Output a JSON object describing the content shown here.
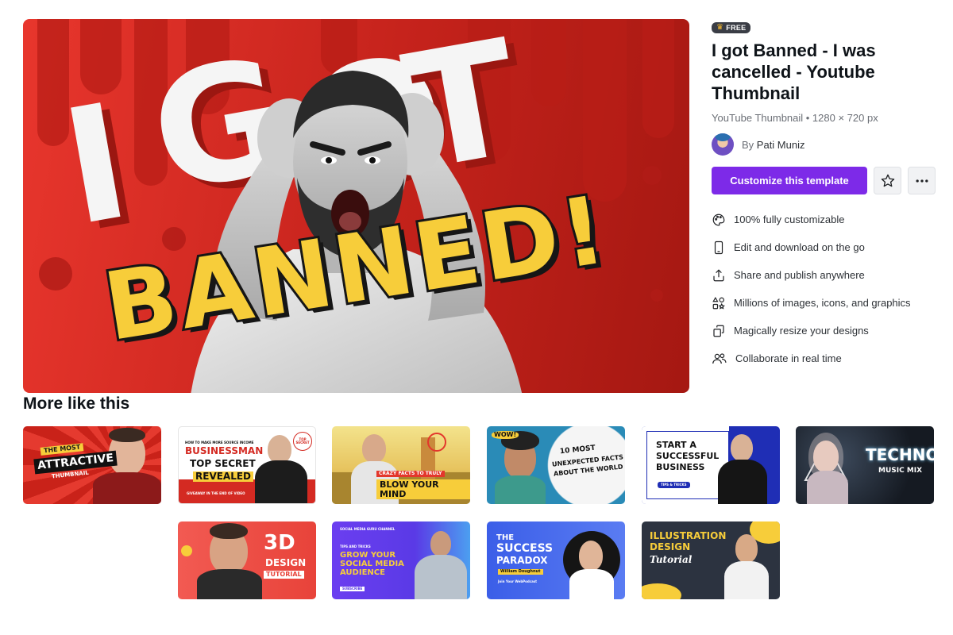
{
  "hero": {
    "big_letters": [
      "I",
      "G",
      "O",
      "T"
    ],
    "headline": "BANNED!"
  },
  "badge": {
    "label": "FREE",
    "icon": "crown-icon"
  },
  "template": {
    "title": "I got Banned - I was cancelled - Youtube Thumbnail",
    "meta": "YouTube Thumbnail • 1280 × 720 px",
    "author_prefix": "By",
    "author_name": "Pati Muniz"
  },
  "actions": {
    "customize_label": "Customize this template",
    "star_icon": "star-icon",
    "more_icon": "more-dots-icon"
  },
  "features": [
    {
      "icon": "palette-icon",
      "label": "100% fully customizable"
    },
    {
      "icon": "phone-icon",
      "label": "Edit and download on the go"
    },
    {
      "icon": "share-icon",
      "label": "Share and publish anywhere"
    },
    {
      "icon": "shapes-icon",
      "label": "Millions of images, icons, and graphics"
    },
    {
      "icon": "resize-icon",
      "label": "Magically resize your designs"
    },
    {
      "icon": "collaborate-icon",
      "label": "Collaborate in real time"
    }
  ],
  "more": {
    "title": "More like this",
    "thumbnails": [
      {
        "lines": [
          "THE MOST",
          "ATTRACTIVE",
          "THUMBNAIL"
        ]
      },
      {
        "lines": [
          "HOW TO MAKE MORE SOURCE INCOME",
          "BUSINESSMAN",
          "TOP SECRET",
          "REVEALED",
          "GIVEAWAY IN THE END OF VIDEO",
          "TOP SECRET"
        ]
      },
      {
        "lines": [
          "CRAZY FACTS TO TRULY",
          "BLOW YOUR MIND"
        ]
      },
      {
        "lines": [
          "WOW!",
          "10 MOST",
          "UNEXPECTED FACTS",
          "ABOUT THE WORLD"
        ]
      },
      {
        "lines": [
          "START A",
          "SUCCESSFUL",
          "BUSINESS",
          "TIPS & TRICKS"
        ]
      },
      {
        "lines": [
          "TECHNO",
          "MUSIC MIX"
        ]
      },
      {
        "lines": [
          "3D",
          "DESIGN",
          "TUTORIAL"
        ]
      },
      {
        "lines": [
          "SOCIAL MEDIA GURU CHANNEL",
          "TIPS AND TRICKS",
          "GROW YOUR",
          "SOCIAL MEDIA",
          "AUDIENCE",
          "SUBSCRIBE"
        ]
      },
      {
        "lines": [
          "THE",
          "SUCCESS",
          "PARADOX",
          "William Doughnut",
          "Join Your WebPodcast"
        ]
      },
      {
        "lines": [
          "ILLUSTRATION",
          "DESIGN",
          "Tutorial"
        ]
      }
    ]
  },
  "colors": {
    "accent": "#7d2ae8",
    "hero_red": "#d3271f",
    "banned_yellow": "#f7cd3a"
  }
}
